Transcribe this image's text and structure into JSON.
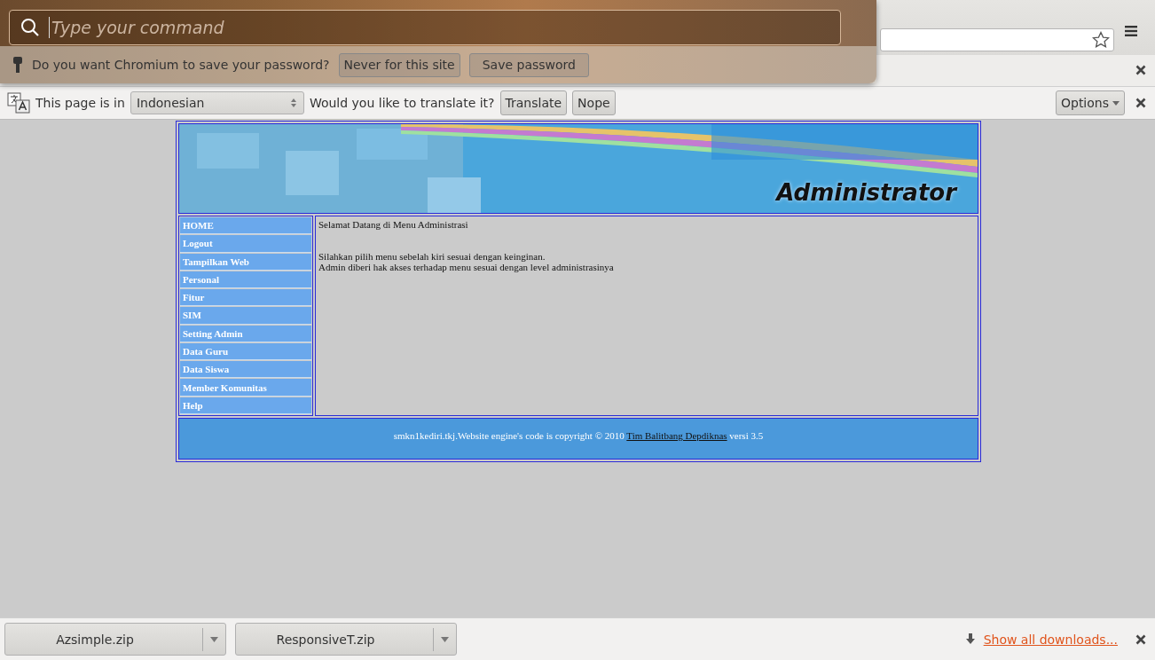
{
  "command_bar": {
    "placeholder": "Type your command"
  },
  "password_bar": {
    "question": "Do you want Chromium to save your password?",
    "buttons": [
      "Never for this site",
      "Save password"
    ]
  },
  "translate_bar": {
    "label": "This page is in",
    "language": "Indonesian",
    "question": "Would you like to translate it?",
    "buttons": [
      "Translate",
      "Nope"
    ],
    "options": "Options"
  },
  "page": {
    "banner_title": "Administrator",
    "menu": [
      "HOME",
      "Logout",
      "Tampilkan Web",
      "Personal",
      "Fitur",
      "SIM",
      "Setting Admin",
      "Data Guru",
      "Data Siswa",
      "Member Komunitas",
      "Help"
    ],
    "welcome": "Selamat Datang di Menu Administrasi",
    "lines": [
      "Silahkan pilih menu sebelah kiri sesuai dengan keinginan.",
      "Admin diberi hak akses terhadap menu sesuai dengan level administrasinya"
    ],
    "footer": {
      "text_before": "smkn1kediri.tkj.Website engine's code is copyright © 2010",
      "link": "Tim Balitbang Depdiknas",
      "text_after": "versi 3.5"
    }
  },
  "downloads": [
    {
      "name": "Azsimple.zip"
    },
    {
      "name": "ResponsiveT.zip"
    }
  ],
  "show_all": "Show all downloads..."
}
